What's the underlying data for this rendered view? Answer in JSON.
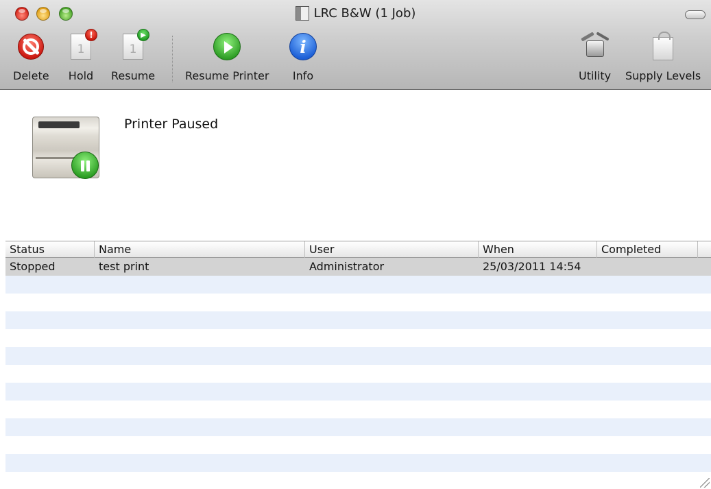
{
  "window": {
    "title": "LRC B&W (1 Job)"
  },
  "toolbar": {
    "items": [
      {
        "label": "Delete",
        "icon": "delete-icon"
      },
      {
        "label": "Hold",
        "icon": "hold-icon",
        "badge": "!"
      },
      {
        "label": "Resume",
        "icon": "resume-icon",
        "page_number": "1"
      },
      {
        "label": "Resume Printer",
        "icon": "play-icon"
      },
      {
        "label": "Info",
        "icon": "info-icon",
        "glyph": "i"
      },
      {
        "label": "Utility",
        "icon": "utility-icon"
      },
      {
        "label": "Supply Levels",
        "icon": "supply-bag-icon"
      }
    ],
    "hold_page_number": "1"
  },
  "printer": {
    "status": "Printer Paused",
    "icon": "printer-paused-icon"
  },
  "jobs_table": {
    "columns": [
      "Status",
      "Name",
      "User",
      "When",
      "Completed"
    ],
    "rows": [
      {
        "status": "Stopped",
        "name": "test print",
        "user": "Administrator",
        "when": "25/03/2011 14:54",
        "completed": ""
      }
    ]
  },
  "colors": {
    "selected_row": "#d3d3d3",
    "stripe": "#e9f0fb",
    "close": "#d5261b",
    "minimize": "#e1a018",
    "zoom": "#4aa52a"
  }
}
